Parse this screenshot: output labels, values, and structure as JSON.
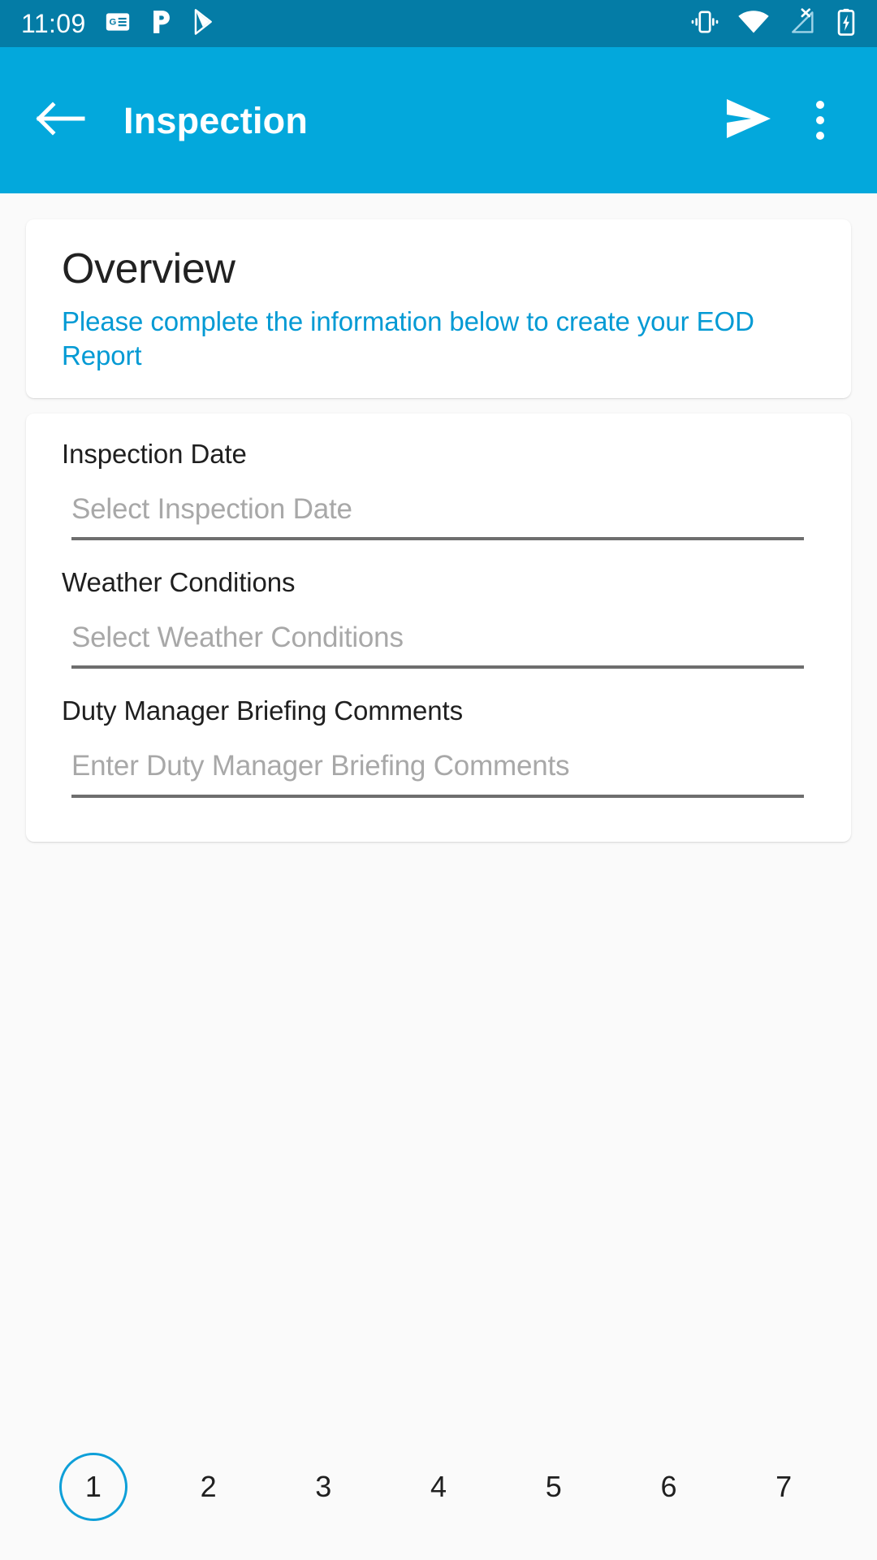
{
  "status_bar": {
    "clock": "11:09",
    "background": "#047ca6",
    "left_icons": [
      {
        "name": "google-news-icon",
        "label": "Google News"
      },
      {
        "name": "pandora-icon",
        "label": "Pandora"
      },
      {
        "name": "play-store-icon",
        "label": "Google Play"
      }
    ],
    "right_icons": [
      {
        "name": "vibrate-mode-icon",
        "label": "Vibrate"
      },
      {
        "name": "wifi-icon",
        "label": "Wi-Fi full signal"
      },
      {
        "name": "no-cellular-signal-icon",
        "label": "No cellular signal"
      },
      {
        "name": "battery-charging-icon",
        "label": "Battery charging"
      }
    ]
  },
  "app_bar": {
    "title": "Inspection",
    "background": "#03a8dc",
    "back_icon": "arrow-left-icon",
    "send_icon": "send-icon",
    "overflow_icon": "more-vertical-icon"
  },
  "overview": {
    "title": "Overview",
    "subtitle": "Please complete the information below to create your EOD Report",
    "subtitle_color": "#039ad4"
  },
  "form": {
    "fields": [
      {
        "label": "Inspection Date",
        "placeholder": "Select Inspection Date",
        "value": "",
        "type": "date-picker"
      },
      {
        "label": "Weather Conditions",
        "placeholder": "Select Weather Conditions",
        "value": "",
        "type": "select"
      },
      {
        "label": "Duty Manager Briefing Comments",
        "placeholder": "Enter Duty Manager Briefing Comments",
        "value": "",
        "type": "text"
      }
    ]
  },
  "pagination": {
    "pages": [
      "1",
      "2",
      "3",
      "4",
      "5",
      "6",
      "7"
    ],
    "active_index": 0,
    "active_color": "#0e9fd8"
  }
}
